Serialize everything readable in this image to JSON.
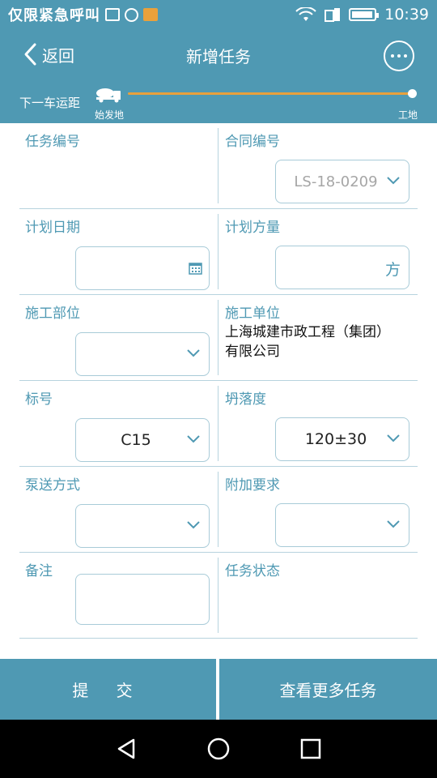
{
  "status_bar": {
    "carrier": "仅限紧急呼叫",
    "time": "10:39"
  },
  "header": {
    "back_label": "返回",
    "title": "新增任务"
  },
  "progress": {
    "label": "下一车运距",
    "start": "始发地",
    "end": "工地",
    "value": 1.0
  },
  "form": {
    "task_no": {
      "label": "任务编号",
      "value": ""
    },
    "contract_no": {
      "label": "合同编号",
      "value": "LS-18-0209"
    },
    "plan_date": {
      "label": "计划日期",
      "value": ""
    },
    "plan_volume": {
      "label": "计划方量",
      "unit": "方",
      "value": ""
    },
    "construction_part": {
      "label": "施工部位",
      "value": ""
    },
    "construction_unit": {
      "label": "施工单位",
      "value": "上海城建市政工程（集团）有限公司"
    },
    "grade": {
      "label": "标号",
      "value": "C15"
    },
    "slump": {
      "label": "坍落度",
      "value": "120±30"
    },
    "pump_method": {
      "label": "泵送方式",
      "value": ""
    },
    "extra_req": {
      "label": "附加要求",
      "value": ""
    },
    "remark": {
      "label": "备注",
      "value": ""
    },
    "task_status": {
      "label": "任务状态",
      "value": ""
    }
  },
  "buttons": {
    "submit": "提 交",
    "view_more": "查看更多任务"
  },
  "colors": {
    "primary": "#4f99b3",
    "accent": "#e8a03c"
  }
}
